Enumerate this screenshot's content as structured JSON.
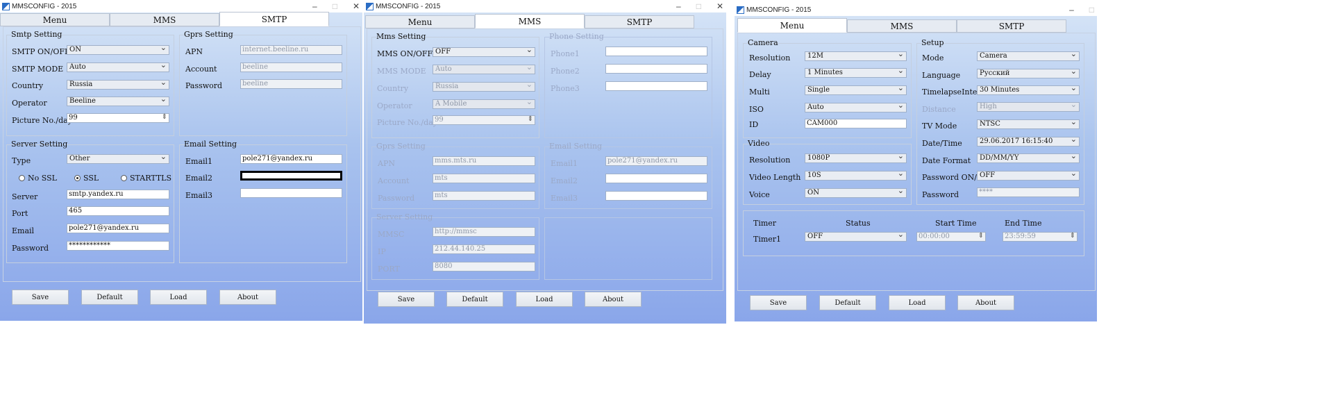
{
  "w1": {
    "title": "MMSCONFIG - 2015",
    "tabs": [
      "Menu",
      "MMS",
      "SMTP"
    ],
    "smtp_setting": {
      "title": "Smtp Setting",
      "smtp_onoff_label": "SMTP ON/OFF",
      "smtp_onoff_value": "ON",
      "smtp_mode_label": "SMTP MODE",
      "smtp_mode_value": "Auto",
      "country_label": "Country",
      "country_value": "Russia",
      "operator_label": "Operator",
      "operator_value": "Beeline",
      "picture_label": "Picture No./day",
      "picture_value": "99"
    },
    "gprs_setting": {
      "title": "Gprs Setting",
      "apn_label": "APN",
      "apn_value": "internet.beeline.ru",
      "account_label": "Account",
      "account_value": "beeline",
      "password_label": "Password",
      "password_value": "beeline"
    },
    "server_setting": {
      "title": "Server Setting",
      "type_label": "Type",
      "type_value": "Other",
      "no_ssl": "No SSL",
      "ssl": "SSL",
      "starttls": "STARTTLS",
      "server_label": "Server",
      "server_value": "smtp.yandex.ru",
      "port_label": "Port",
      "port_value": "465",
      "email_label": "Email",
      "email_value": "pole271@yandex.ru",
      "password_label": "Password",
      "password_value": "************"
    },
    "email_setting": {
      "title": "Email Setting",
      "email1_label": "Email1",
      "email1_value": "pole271@yandex.ru",
      "email2_label": "Email2",
      "email2_value": "",
      "email3_label": "Email3",
      "email3_value": ""
    },
    "buttons": {
      "save": "Save",
      "default": "Default",
      "load": "Load",
      "about": "About"
    }
  },
  "w2": {
    "title": "MMSCONFIG - 2015",
    "tabs": [
      "Menu",
      "MMS",
      "SMTP"
    ],
    "mms_setting": {
      "title": "Mms Setting",
      "mms_onoff_label": "MMS ON/OFF",
      "mms_onoff_value": "OFF",
      "mms_mode_label": "MMS MODE",
      "mms_mode_value": "Auto",
      "country_label": "Country",
      "country_value": "Russia",
      "operator_label": "Operator",
      "operator_value": "A Mobile",
      "picture_label": "Picture No./day",
      "picture_value": "99"
    },
    "phone_setting": {
      "title": "Phone Setting",
      "phone1": "Phone1",
      "phone2": "Phone2",
      "phone3": "Phone3"
    },
    "gprs_setting": {
      "title": "Gprs Setting",
      "apn_label": "APN",
      "apn_value": "mms.mts.ru",
      "account_label": "Account",
      "account_value": "mts",
      "password_label": "Password",
      "password_value": "mts"
    },
    "email_setting": {
      "title": "Email Setting",
      "email1_label": "Email1",
      "email1_value": "pole271@yandex.ru",
      "email2_label": "Email2",
      "email3_label": "Email3"
    },
    "server_setting": {
      "title": "Server Setting",
      "mmsc_label": "MMSC",
      "mmsc_value": "http://mmsc",
      "ip_label": "IP",
      "ip_value": "212.44.140.25",
      "port_label": "PORT",
      "port_value": "8080"
    },
    "buttons": {
      "save": "Save",
      "default": "Default",
      "load": "Load",
      "about": "About"
    }
  },
  "w3": {
    "title": "MMSCONFIG - 2015",
    "tabs": [
      "Menu",
      "MMS",
      "SMTP"
    ],
    "camera": {
      "title": "Camera",
      "resolution_label": "Resolution",
      "resolution_value": "12M",
      "delay_label": "Delay",
      "delay_value": "1  Minutes",
      "multi_label": "Multi",
      "multi_value": "Single",
      "iso_label": "ISO",
      "iso_value": "Auto",
      "id_label": "ID",
      "id_value": "CAM000"
    },
    "video": {
      "title": "Video",
      "resolution_label": "Resolution",
      "resolution_value": "1080P",
      "length_label": "Video Length",
      "length_value": "10S",
      "voice_label": "Voice",
      "voice_value": "ON"
    },
    "setup": {
      "title": "Setup",
      "mode_label": "Mode",
      "mode_value": "Camera",
      "language_label": "Language",
      "language_value": "Русский",
      "timelapse_label": "TimelapseInterval",
      "timelapse_value": "30   Minutes",
      "distance_label": "Distance",
      "distance_value": "High",
      "tvmode_label": "TV Mode",
      "tvmode_value": "NTSC",
      "datetime_label": "Date/Time",
      "datetime_value": "29.06.2017 16:15:40",
      "dateformat_label": "Date Format",
      "dateformat_value": "DD/MM/YY",
      "pwonoff_label": "Password ON/OFF",
      "pwonoff_value": "OFF",
      "password_label": "Password",
      "password_value": "****"
    },
    "timer": {
      "timer_header": "Timer",
      "status_header": "Status",
      "start_header": "Start Time",
      "end_header": "End Time",
      "timer1_label": "Timer1",
      "status_value": "OFF",
      "start_value": "00:00:00",
      "end_value": "23:59:59"
    },
    "buttons": {
      "save": "Save",
      "default": "Default",
      "load": "Load",
      "about": "About"
    }
  }
}
